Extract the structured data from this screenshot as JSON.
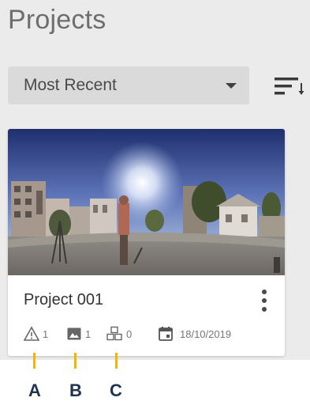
{
  "page": {
    "title": "Projects"
  },
  "sort": {
    "selected": "Most Recent"
  },
  "project": {
    "title": "Project 001",
    "issues_count": "1",
    "images_count": "1",
    "models_count": "0",
    "date": "18/10/2019"
  },
  "callouts": [
    "A",
    "B",
    "C"
  ],
  "colors": {
    "callout_line": "#f5b400",
    "callout_letter": "#1f3350"
  },
  "icons": {
    "sort": "sort-lines-icon",
    "dropdown": "caret-down-icon",
    "more": "more-vertical-icon",
    "issues": "warning-triangle-icon",
    "images": "image-icon",
    "models": "cubes-icon",
    "date": "calendar-icon"
  }
}
